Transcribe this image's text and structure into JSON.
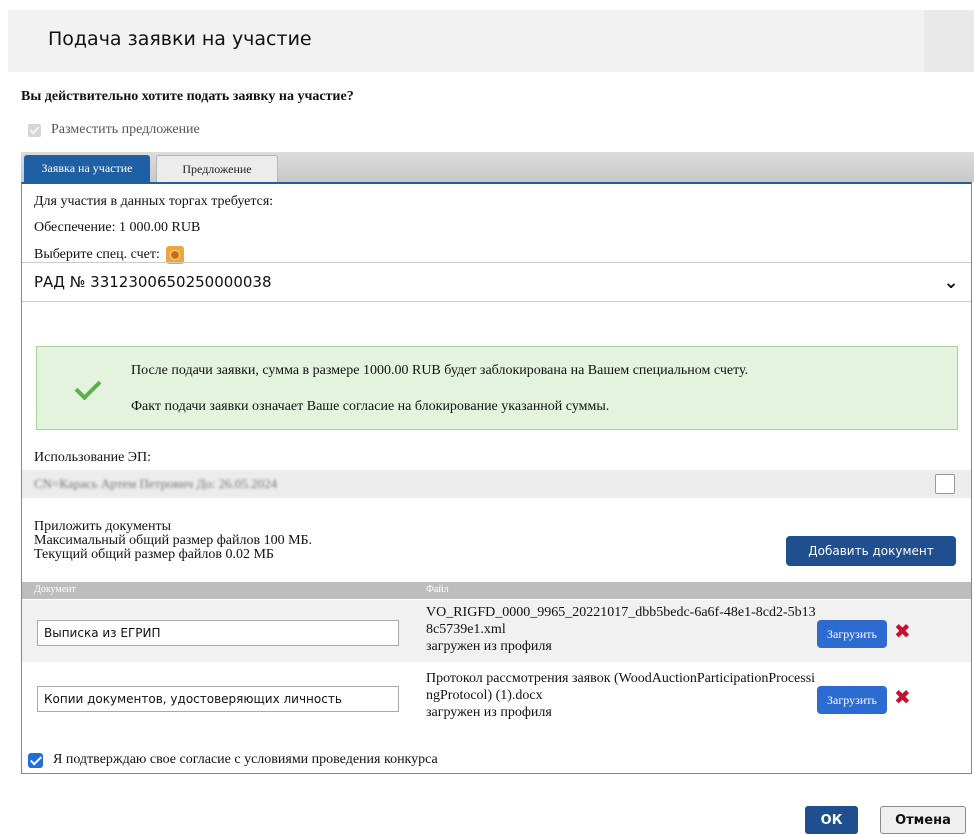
{
  "dialog": {
    "title": "Подача заявки на участие"
  },
  "question": "Вы действительно хотите подать заявку на участие?",
  "place_offer": {
    "label": "Разместить предложение",
    "checked": true,
    "disabled": true
  },
  "tabs": [
    {
      "label": "Заявка на участие",
      "active": true
    },
    {
      "label": "Предложение",
      "active": false
    }
  ],
  "requirements": {
    "heading": "Для участия в данных торгах требуется:",
    "security": "Обеспечение:  1 000.00 RUB",
    "select_account_label": "Выберите спец. счет:"
  },
  "account_select": {
    "value": "РАД № 3312300650250000038"
  },
  "alert": {
    "line1": "После подачи заявки, сумма в размере 1000.00 RUB будет заблокирована на Вашем специальном счету.",
    "line2": "Факт подачи заявки означает Ваше согласие на блокирование указанной суммы."
  },
  "signature": {
    "label": "Использование ЭП:",
    "value": "CN=Карась Артем Петрович До: 26.05.2024",
    "checked": false
  },
  "attachments": {
    "title": "Приложить документы",
    "max_size": "Максимальный общий размер файлов 100 МБ.",
    "current_size": "Текущий общий размер файлов 0.02 МБ",
    "add_button": "Добавить документ",
    "columns": [
      "Документ",
      "Файл"
    ],
    "rows": [
      {
        "document": "Выписка из ЕГРИП",
        "file": "VO_RIGFD_0000_9965_20221017_dbb5bedc-6a6f-48e1-8cd2-5b138c5739e1.xml",
        "source": "загружен из профиля",
        "upload_label": "Загрузить"
      },
      {
        "document": "Копии документов, удостоверяющих личность",
        "file": "Протокол рассмотрения заявок (WoodAuctionParticipationProcessingProtocol) (1).docx",
        "source": "загружен из профиля",
        "upload_label": "Загрузить"
      }
    ]
  },
  "agreement": {
    "label": "Я подтверждаю свое согласие с условиями проведения конкурса",
    "checked": true
  },
  "footer": {
    "ok": "ОК",
    "cancel": "Отмена"
  },
  "colors": {
    "primary": "#1f4f8f",
    "tab_active": "#1f5fa3",
    "alert_bg": "#e4f3de",
    "delete": "#c8102e"
  }
}
